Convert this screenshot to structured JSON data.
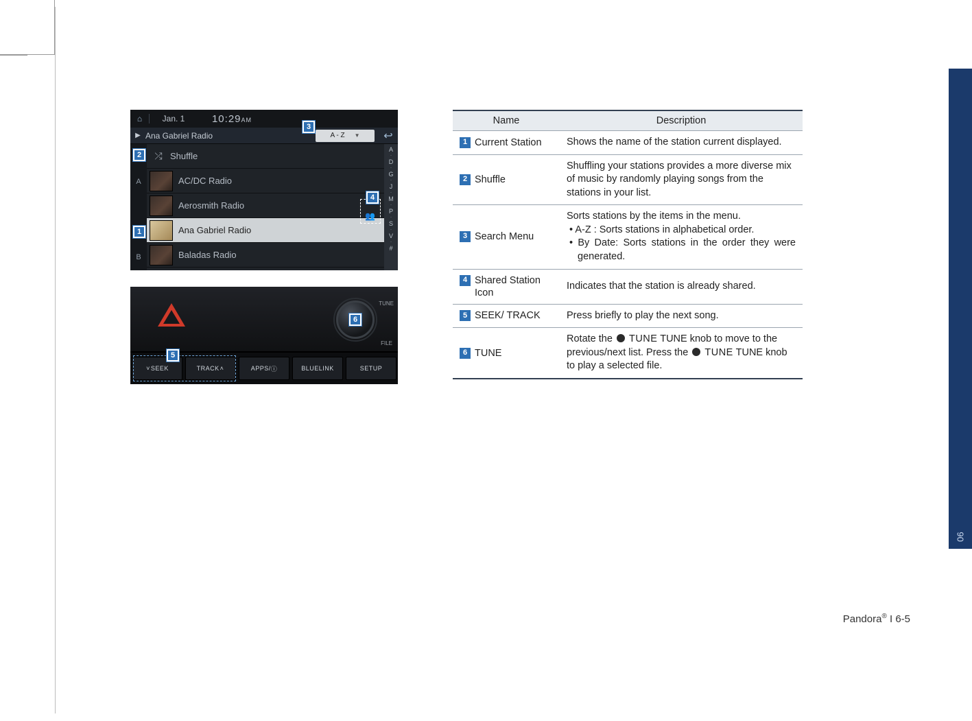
{
  "screen": {
    "date": "Jan. 1",
    "time": "10:29",
    "ampm": "AM",
    "current_station": "Ana Gabriel Radio",
    "search_dropdown": "A - Z",
    "rows": {
      "shuffle": "Shuffle",
      "r1": "AC/DC Radio",
      "r2": "Aerosmith Radio",
      "r3": "Ana Gabriel Radio",
      "r4": "Baladas Radio"
    },
    "left_letters": {
      "a": "A",
      "b": "B"
    },
    "az": {
      "a": "A",
      "d": "D",
      "g": "G",
      "j": "J",
      "m": "M",
      "p": "P",
      "s": "S",
      "v": "V",
      "hash": "#"
    }
  },
  "device": {
    "tune_label": "TUNE",
    "file_label": "FILE",
    "btn_seek_left": "SEEK",
    "btn_track_right": "TRACK",
    "btn_apps": "APPS/",
    "btn_bluelink": "BLUELINK",
    "btn_setup": "SETUP"
  },
  "callouts": {
    "1": "1",
    "2": "2",
    "3": "3",
    "4": "4",
    "5": "5",
    "6": "6"
  },
  "table": {
    "head_name": "Name",
    "head_desc": "Description",
    "rows": {
      "1": {
        "n": "1",
        "name": "Current Station",
        "desc": "Shows the name of the station current displayed."
      },
      "2": {
        "n": "2",
        "name": "Shuffle",
        "desc": "Shuffling your stations provides a more diverse mix of music by randomly playing songs from the stations in your list."
      },
      "3": {
        "n": "3",
        "name": "Search Menu",
        "desc_lead": "Sorts stations by the items in the menu.",
        "b1": "A-Z : Sorts stations in alphabetical order.",
        "b2": "By Date: Sorts stations in the order they were generated."
      },
      "4": {
        "n": "4",
        "name": "Shared Station Icon",
        "desc": "Indicates that the station is already shared."
      },
      "5": {
        "n": "5",
        "name": "SEEK/ TRACK",
        "desc": "Press briefly to play the next song."
      },
      "6": {
        "n": "6",
        "name": "TUNE",
        "desc_a": "Rotate the ",
        "desc_b": " TUNE knob to move to the previous/next list. Press the ",
        "desc_c": " TUNE knob to play a selected file."
      },
      "6_knob1": "TUNE",
      "6_knob2": "TUNE"
    }
  },
  "side_tab": "06",
  "footer": {
    "product": "Pandora",
    "reg": "®",
    "page": " I 6-5"
  }
}
